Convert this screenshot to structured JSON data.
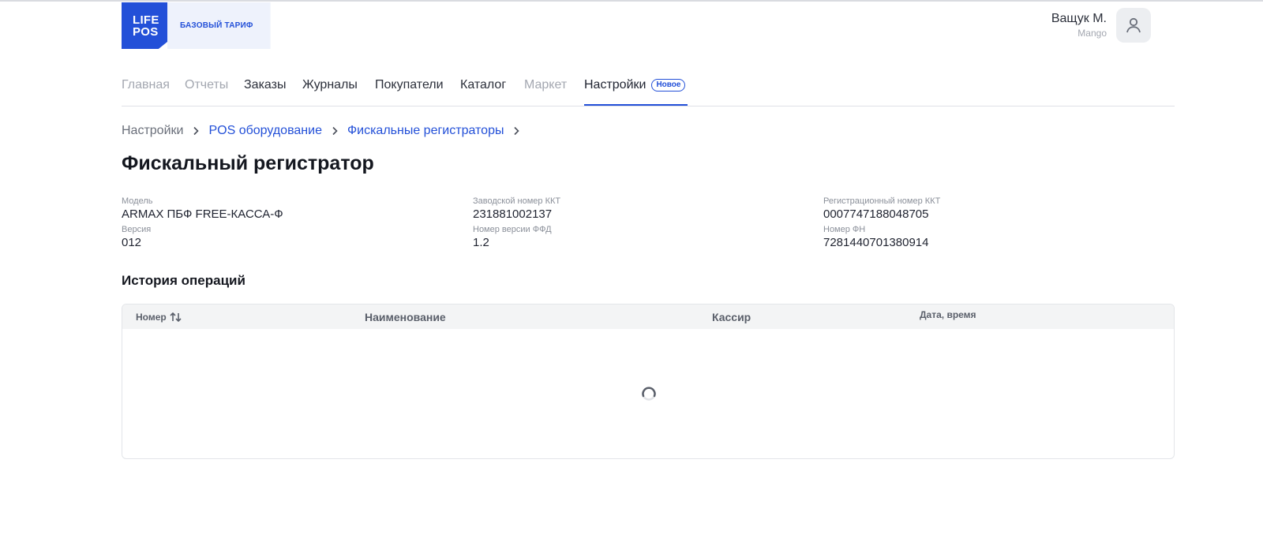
{
  "brand": {
    "logo_line1": "LIFE",
    "logo_line2": "POS",
    "tariff": "БАЗОВЫЙ ТАРИФ",
    "accent": "#2350d8"
  },
  "user": {
    "name": "Ващук М.",
    "org": "Mango",
    "icon": "user-icon"
  },
  "nav": {
    "items": [
      {
        "label": "Главная",
        "state": "muted"
      },
      {
        "label": "Отчеты",
        "state": "muted"
      },
      {
        "label": "Заказы",
        "state": "normal"
      },
      {
        "label": "Журналы",
        "state": "normal"
      },
      {
        "label": "Покупатели",
        "state": "normal"
      },
      {
        "label": "Каталог",
        "state": "normal"
      },
      {
        "label": "Маркет",
        "state": "muted"
      },
      {
        "label": "Настройки",
        "state": "active"
      }
    ],
    "badge": "Новое"
  },
  "breadcrumbs": [
    "Настройки",
    "POS оборудование",
    "Фискальные регистраторы"
  ],
  "page_title": "Фискальный регистратор",
  "info": {
    "model_label": "Модель",
    "model_value": "ARMAX ПБФ FREE-КАССА-Ф",
    "version_label": "Версия",
    "version_value": "012",
    "serial_label": "Заводской номер ККТ",
    "serial_value": "231881002137",
    "ffd_label": "Номер версии ФФД",
    "ffd_value": "1.2",
    "reg_label": "Регистрационный номер ККТ",
    "reg_value": "0007747188048705",
    "fn_label": "Номер ФН",
    "fn_value": "7281440701380914"
  },
  "history": {
    "title": "История операций",
    "columns": [
      "Номер",
      "Наименование",
      "Кассир",
      "Дата, время"
    ],
    "loading": true
  }
}
